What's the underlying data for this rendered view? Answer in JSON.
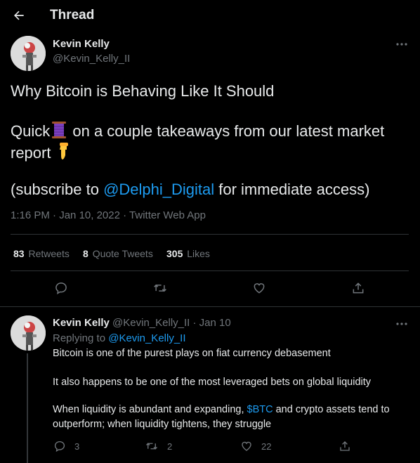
{
  "header": {
    "title": "Thread"
  },
  "main_tweet": {
    "author_name": "Kevin Kelly",
    "author_handle": "@Kevin_Kelly_II",
    "line1": "Why Bitcoin is Behaving Like It Should",
    "line2_prefix": "Quick",
    "line2_suffix": "on a couple takeaways from our latest market",
    "line3": "report",
    "line4_prefix": "(subscribe to ",
    "line4_mention": "@Delphi_Digital",
    "line4_suffix": " for immediate access)",
    "time": "1:16 PM",
    "date": "Jan 10, 2022",
    "source": "Twitter Web App",
    "separator": " · ",
    "stats": {
      "retweets_count": "83",
      "retweets_label": "Retweets",
      "quotes_count": "8",
      "quotes_label": "Quote Tweets",
      "likes_count": "305",
      "likes_label": "Likes"
    },
    "icons": [
      "reply-icon",
      "retweet-icon",
      "like-icon",
      "share-icon"
    ]
  },
  "reply_tweet": {
    "author_name": "Kevin Kelly",
    "author_handle": "@Kevin_Kelly_II",
    "separator": " · ",
    "date": "Jan 10",
    "replying_prefix": "Replying to ",
    "replying_to": "@Kevin_Kelly_II",
    "para1": "Bitcoin is one of the purest plays on fiat currency debasement",
    "para2": "It also happens to be one of the most leveraged bets on global liquidity",
    "para3_prefix": "When liquidity is abundant and expanding, ",
    "para3_cashtag": "$BTC",
    "para3_suffix": " and crypto assets tend to",
    "para3_line2": "outperform; when liquidity tightens, they struggle",
    "reply_count": "3",
    "retweet_count": "2",
    "like_count": "22"
  },
  "colors": {
    "background": "#000000",
    "text": "#e7e9ea",
    "secondary": "#71767b",
    "accent": "#1d9bf0",
    "border": "#2f3336"
  }
}
